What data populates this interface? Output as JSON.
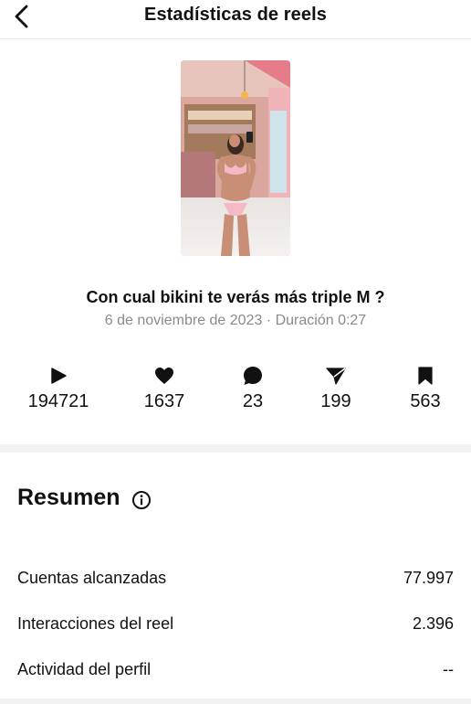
{
  "header": {
    "title": "Estadísticas de reels",
    "back_icon": "chevron-left-icon"
  },
  "reel": {
    "caption": "Con cual bikini te verás más triple M ?",
    "meta": "6 de noviembre de 2023 · Duración 0:27"
  },
  "stats": [
    {
      "icon": "play-icon",
      "value": "194721"
    },
    {
      "icon": "heart-icon",
      "value": "1637"
    },
    {
      "icon": "comment-icon",
      "value": "23"
    },
    {
      "icon": "share-icon",
      "value": "199"
    },
    {
      "icon": "save-icon",
      "value": "563"
    }
  ],
  "summary": {
    "title": "Resumen",
    "info_icon": "info-icon",
    "rows": [
      {
        "label": "Cuentas alcanzadas",
        "value": "77.997"
      },
      {
        "label": "Interacciones del reel",
        "value": "2.396"
      },
      {
        "label": "Actividad del perfil",
        "value": "--"
      }
    ]
  },
  "colors": {
    "text": "#111111",
    "muted": "#8a8a8a",
    "divider": "#f2f2f2"
  }
}
